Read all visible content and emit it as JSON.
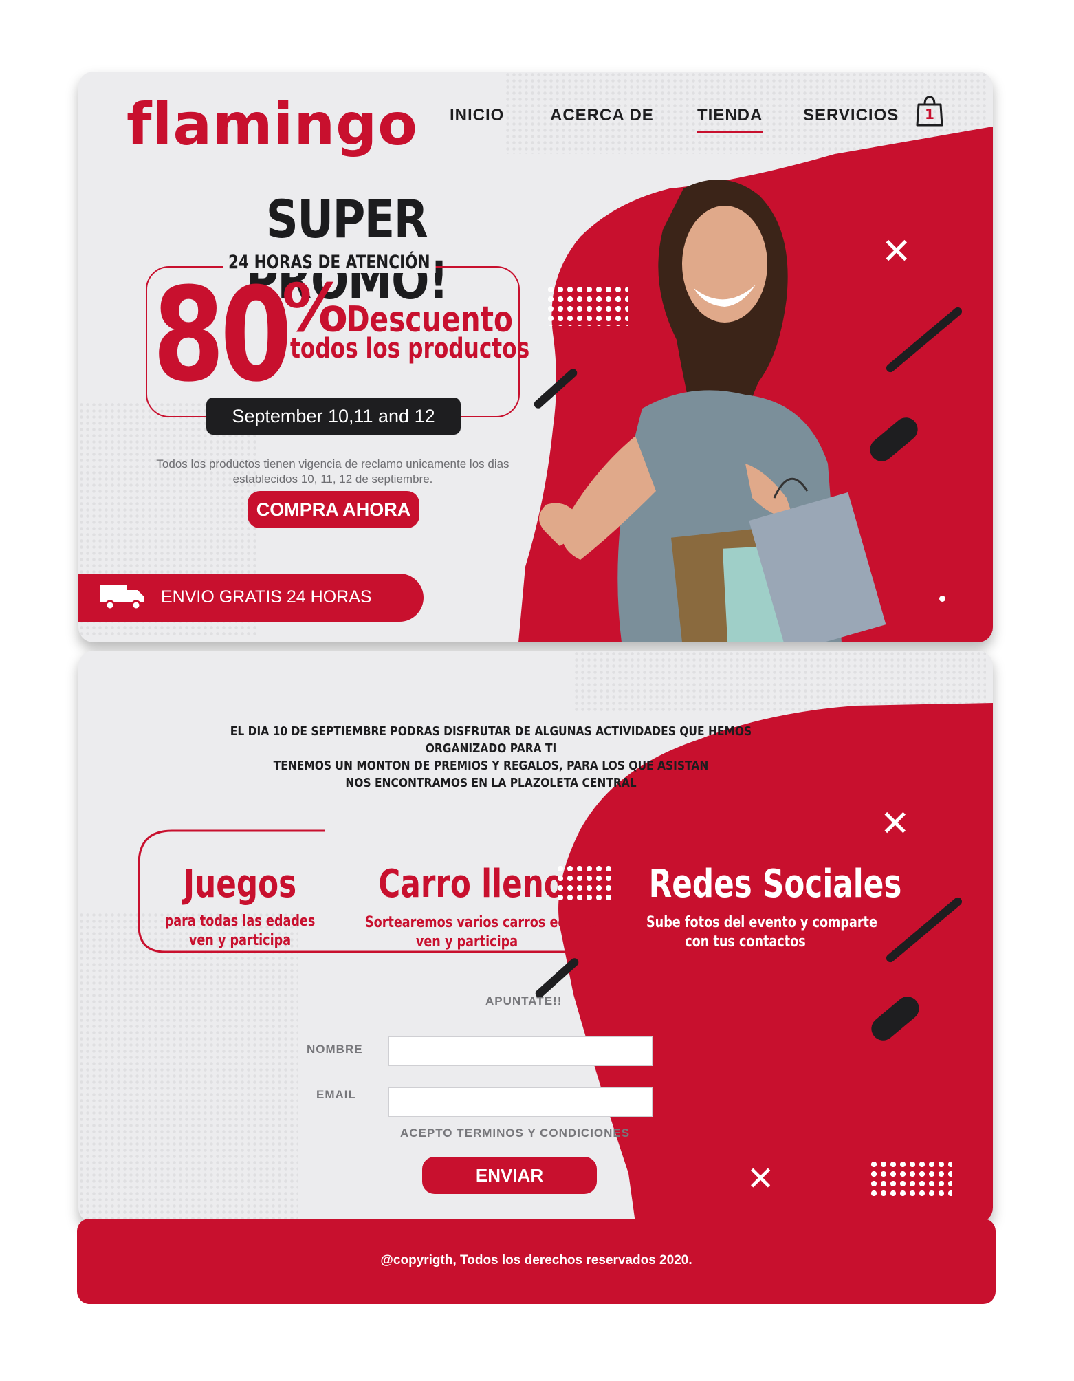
{
  "brand": {
    "name": "flamingo",
    "primary_color": "#c8102e",
    "dark_color": "#1e1e20"
  },
  "nav": {
    "items": [
      {
        "label": "INICIO"
      },
      {
        "label": "ACERCA DE"
      },
      {
        "label": "TIENDA",
        "active": true
      },
      {
        "label": "SERVICIOS"
      }
    ],
    "cart_count": "1",
    "cart_icon": "shopping-bag-icon"
  },
  "hero": {
    "title": "SUPER PROMO!",
    "subtitle": "24 HORAS DE ATENCIÓN",
    "discount_number": "80",
    "discount_symbol": "%",
    "discount_word": "Descuento",
    "discount_scope": "todos los productos",
    "dates": "September 10,11 and 12",
    "fine_print": "Todos los productos tienen vigencia de reclamo unicamente los dias establecidos 10, 11, 12 de septiembre.",
    "cta_label": "COMPRA AHORA",
    "shipping_label": "ENVIO GRATIS 24 HORAS",
    "shipping_icon": "delivery-truck-icon"
  },
  "event": {
    "intro_lines": [
      "EL DIA 10 DE SEPTIEMBRE PODRAS DISFRUTAR DE ALGUNAS ACTIVIDADES QUE HEMOS ORGANIZADO PARA TI",
      "TENEMOS UN MONTON DE PREMIOS Y REGALOS, PARA LOS QUE ASISTAN",
      "NOS ENCONTRAMOS EN LA PLAZOLETA CENTRAL"
    ],
    "activities": [
      {
        "title": "Juegos",
        "desc1": "para todas las edades",
        "desc2": "ven y participa"
      },
      {
        "title": "Carro lleno",
        "desc1": "Sortearemos varios carros edades",
        "desc2": "ven y participa"
      },
      {
        "title": "Redes Sociales",
        "desc1": "Sube fotos del evento y comparte",
        "desc2": "con tus contactos"
      }
    ]
  },
  "form": {
    "heading": "APUNTATE!!",
    "name_label": "NOMBRE",
    "name_value": "",
    "email_label": "EMAIL",
    "email_value": "",
    "terms_label": "ACEPTO TERMINOS Y CONDICIONES",
    "submit_label": "ENVIAR"
  },
  "footer": {
    "text": "@copyrigth, Todos los derechos reservados 2020."
  }
}
